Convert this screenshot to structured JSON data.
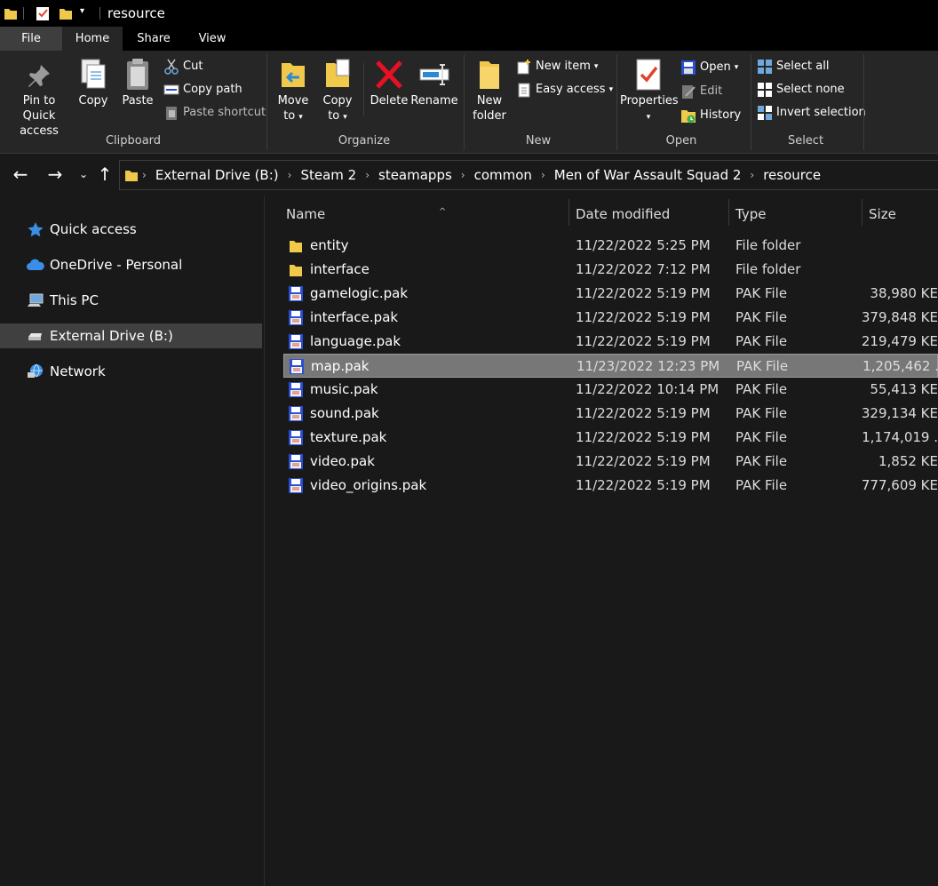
{
  "window": {
    "title": "resource"
  },
  "ribbon_tabs": [
    "File",
    "Home",
    "Share",
    "View"
  ],
  "ribbon": {
    "clipboard": {
      "pin_label": "Pin to Quick access",
      "pin_line1": "Pin to Quick",
      "pin_line2": "access",
      "copy_label": "Copy",
      "paste_label": "Paste",
      "cut_label": "Cut",
      "copy_path_label": "Copy path",
      "paste_shortcut_label": "Paste shortcut",
      "group_label": "Clipboard"
    },
    "organize": {
      "move_line1": "Move",
      "move_line2": "to",
      "copy_line1": "Copy",
      "copy_line2": "to",
      "delete_label": "Delete",
      "rename_label": "Rename",
      "group_label": "Organize"
    },
    "new": {
      "new_folder_line1": "New",
      "new_folder_line2": "folder",
      "new_item_label": "New item",
      "easy_access_label": "Easy access",
      "group_label": "New"
    },
    "open": {
      "properties_label": "Properties",
      "open_label": "Open",
      "edit_label": "Edit",
      "history_label": "History",
      "group_label": "Open"
    },
    "select": {
      "select_all_label": "Select all",
      "select_none_label": "Select none",
      "invert_selection_label": "Invert selection",
      "group_label": "Select"
    }
  },
  "breadcrumb": [
    "External Drive (B:)",
    "Steam 2",
    "steamapps",
    "common",
    "Men of War Assault Squad 2",
    "resource"
  ],
  "nav_pane": {
    "items": [
      {
        "label": "Quick access",
        "icon": "star-icon"
      },
      {
        "label": "OneDrive - Personal",
        "icon": "cloud-icon"
      },
      {
        "label": "This PC",
        "icon": "computer-icon"
      },
      {
        "label": "External Drive (B:)",
        "icon": "drive-icon",
        "selected": true
      },
      {
        "label": "Network",
        "icon": "network-icon"
      }
    ]
  },
  "file_list": {
    "columns": [
      "Name",
      "Date modified",
      "Type",
      "Size"
    ],
    "rows": [
      {
        "name": "entity",
        "date": "11/22/2022 5:25 PM",
        "type": "File folder",
        "size": "",
        "kind": "folder"
      },
      {
        "name": "interface",
        "date": "11/22/2022 7:12 PM",
        "type": "File folder",
        "size": "",
        "kind": "folder"
      },
      {
        "name": "gamelogic.pak",
        "date": "11/22/2022 5:19 PM",
        "type": "PAK File",
        "size": "38,980 KE",
        "kind": "pak"
      },
      {
        "name": "interface.pak",
        "date": "11/22/2022 5:19 PM",
        "type": "PAK File",
        "size": "379,848 KE",
        "kind": "pak"
      },
      {
        "name": "language.pak",
        "date": "11/22/2022 5:19 PM",
        "type": "PAK File",
        "size": "219,479 KE",
        "kind": "pak"
      },
      {
        "name": "map.pak",
        "date": "11/23/2022 12:23 PM",
        "type": "PAK File",
        "size": "1,205,462 .",
        "kind": "pak",
        "selected": true
      },
      {
        "name": "music.pak",
        "date": "11/22/2022 10:14 PM",
        "type": "PAK File",
        "size": "55,413 KE",
        "kind": "pak"
      },
      {
        "name": "sound.pak",
        "date": "11/22/2022 5:19 PM",
        "type": "PAK File",
        "size": "329,134 KE",
        "kind": "pak"
      },
      {
        "name": "texture.pak",
        "date": "11/22/2022 5:19 PM",
        "type": "PAK File",
        "size": "1,174,019 .",
        "kind": "pak"
      },
      {
        "name": "video.pak",
        "date": "11/22/2022 5:19 PM",
        "type": "PAK File",
        "size": "1,852 KE",
        "kind": "pak"
      },
      {
        "name": "video_origins.pak",
        "date": "11/22/2022 5:19 PM",
        "type": "PAK File",
        "size": "777,609 KE",
        "kind": "pak"
      }
    ]
  },
  "colors": {
    "folder": "#f0c84a",
    "pak_blue": "#2a4fd0",
    "accent_red": "#e81123",
    "selection": "#777777"
  }
}
